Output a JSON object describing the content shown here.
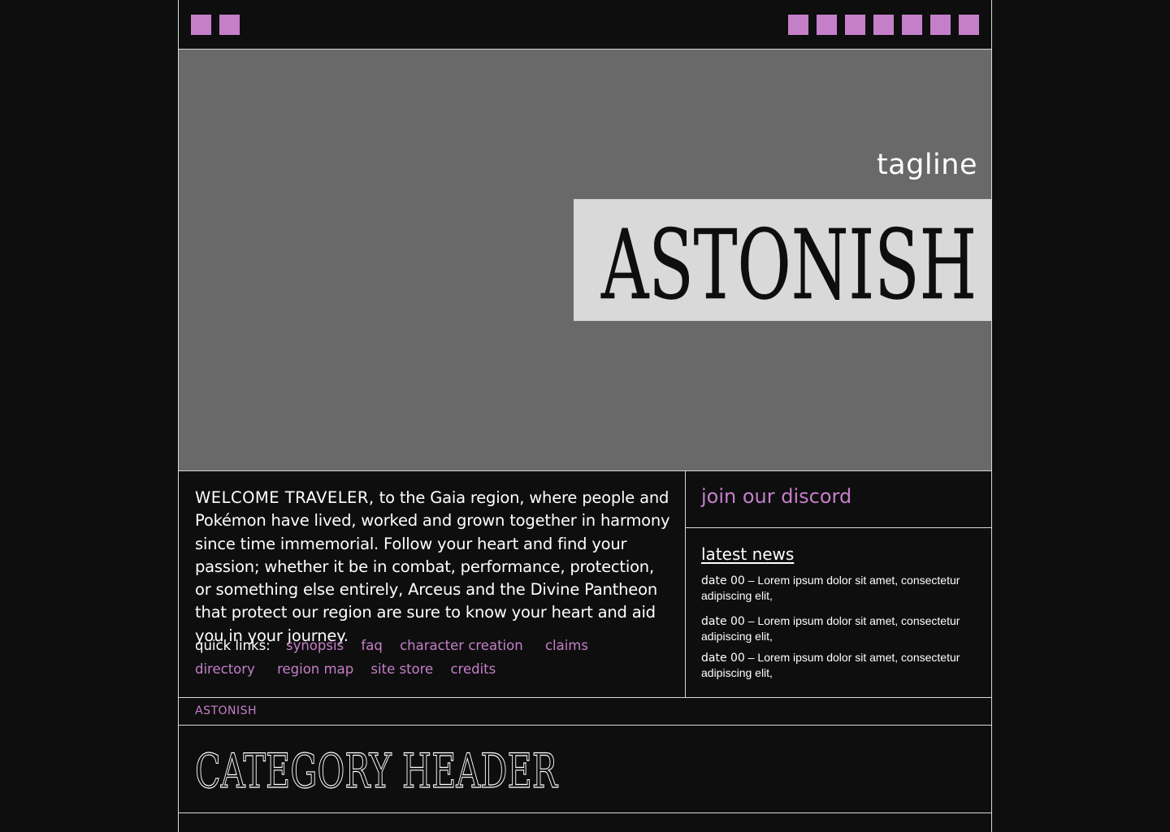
{
  "colors": {
    "background": "#0e0e0e",
    "hero": "#696969",
    "title_box": "#d9d9d9",
    "accent": "#c57fc9",
    "border": "#d9d9d9",
    "text": "#ffffff"
  },
  "nav": {
    "left_buttons": [
      {
        "icon": "square-icon"
      },
      {
        "icon": "square-icon"
      }
    ],
    "right_buttons": [
      {
        "icon": "square-icon"
      },
      {
        "icon": "square-icon"
      },
      {
        "icon": "square-icon"
      },
      {
        "icon": "square-icon"
      },
      {
        "icon": "square-icon"
      },
      {
        "icon": "square-icon"
      },
      {
        "icon": "square-icon"
      }
    ]
  },
  "hero": {
    "tagline": "tagline",
    "title": "ASTONISH"
  },
  "welcome": {
    "lead": "WELCOME TRAVELER,",
    "body": " to the Gaia region, where people and Pokémon have lived, worked and grown together in harmony since time  immemorial. Follow your heart and find your passion; whether it be in  combat, performance, protection, or something else entirely, Arceus and the Divine Pantheon that protect our region are sure to know your heart and aid you in your journey."
  },
  "quick_links": {
    "label": "quick links:",
    "links": [
      "synopsis",
      "faq",
      "character creation",
      "claims",
      "directory",
      "region map",
      "site store",
      "credits"
    ]
  },
  "discord": {
    "label": "join our discord"
  },
  "news": {
    "title": "latest news",
    "items": [
      {
        "date": "date 00",
        "separator": " – ",
        "text": "Lorem ipsum dolor sit amet, consectetur adipiscing elit,"
      },
      {
        "date": "date 00",
        "separator": " – ",
        "text": "Lorem ipsum dolor sit amet, consectetur adipiscing elit,"
      },
      {
        "date": "date 00",
        "separator": " – ",
        "text": "Lorem ipsum dolor sit amet, consectetur adipiscing elit,"
      }
    ]
  },
  "site_label": "ASTONISH",
  "category": {
    "header": "CATEGORY HEADER"
  }
}
